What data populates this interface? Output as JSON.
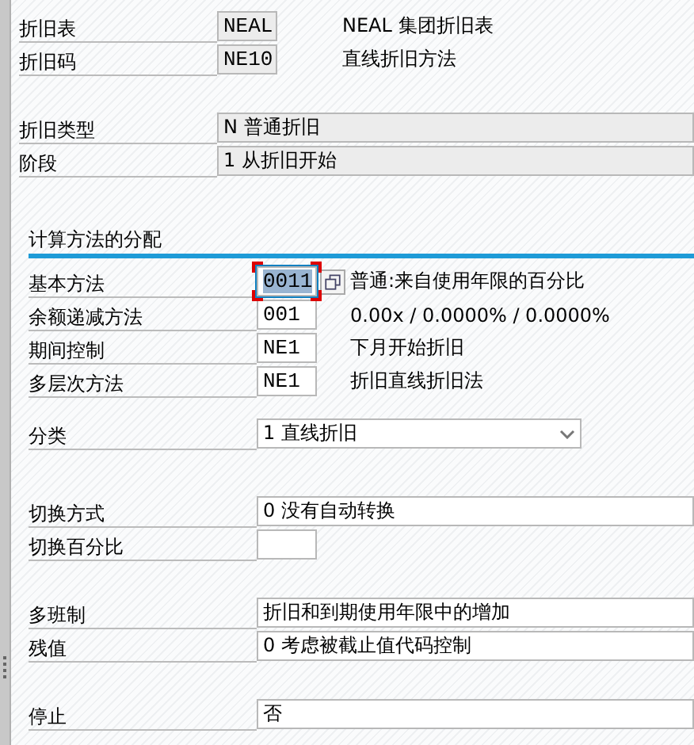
{
  "header_groups": [
    [
      {
        "label": "折旧表",
        "kind": "code",
        "value": "NEAL",
        "editable": false,
        "focused": false,
        "description": "NEAL 集团折旧表"
      },
      {
        "label": "折旧码",
        "kind": "code",
        "value": "NE10",
        "editable": false,
        "focused": false,
        "description": "直线折旧方法"
      }
    ],
    [
      {
        "label": "折旧类型",
        "kind": "text",
        "value": "N 普通折旧",
        "editable": false
      },
      {
        "label": "阶段",
        "kind": "text",
        "value": "1 从折旧开始",
        "editable": false
      }
    ]
  ],
  "section": {
    "title": "计算方法的分配",
    "groups": [
      [
        {
          "label": "基本方法",
          "kind": "code",
          "value": "0011",
          "editable": true,
          "focused": true,
          "description": "普通:来自使用年限的百分比"
        },
        {
          "label": "余额递减方法",
          "kind": "code",
          "value": "001",
          "editable": true,
          "focused": false,
          "description": "0.00x / 0.0000% / 0.0000%"
        },
        {
          "label": "期间控制",
          "kind": "code",
          "value": "NE1",
          "editable": true,
          "focused": false,
          "description": "下月开始折旧"
        },
        {
          "label": "多层次方法",
          "kind": "code",
          "value": "NE1",
          "editable": true,
          "focused": false,
          "description": "折旧直线折旧法"
        }
      ],
      [
        {
          "label": "分类",
          "kind": "dropdown",
          "value": "1 直线折旧",
          "editable": true
        }
      ],
      [
        {
          "label": "切换方式",
          "kind": "text",
          "value": "0 没有自动转换",
          "editable": true
        },
        {
          "label": "切换百分比",
          "kind": "code",
          "editable": true,
          "focused": false
        }
      ],
      [
        {
          "label": "多班制",
          "kind": "text",
          "value": " 折旧和到期使用年限中的增加",
          "editable": true
        },
        {
          "label": "残值",
          "kind": "text",
          "value": "0 考虑被截止值代码控制",
          "editable": true
        }
      ],
      [
        {
          "label": "停止",
          "kind": "text",
          "value": "否",
          "editable": true
        }
      ]
    ]
  }
}
